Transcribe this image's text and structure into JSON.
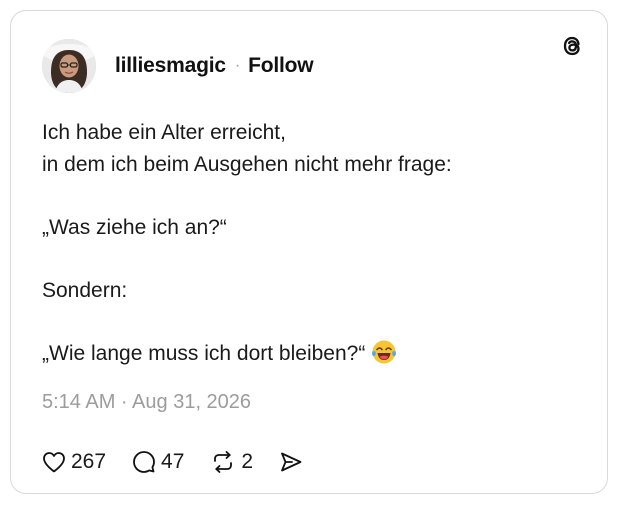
{
  "post": {
    "author": {
      "username": "lilliesmagic",
      "avatar_icon": "profile-photo"
    },
    "separator": "·",
    "follow_label": "Follow",
    "brand_icon": "threads-logo",
    "lines": [
      "Ich habe ein Alter erreicht,",
      "in dem ich beim Ausgehen nicht mehr frage:",
      "",
      "„Was ziehe ich an?“",
      "",
      "Sondern:",
      "",
      "„Wie lange muss ich dort bleiben?“"
    ],
    "trailing_emoji": "face-with-tears-of-joy",
    "timestamp": "5:14 AM · Aug 31, 2026",
    "actions": {
      "likes": {
        "icon": "heart-icon",
        "count": "267"
      },
      "replies": {
        "icon": "comment-icon",
        "count": "47"
      },
      "reposts": {
        "icon": "repost-icon",
        "count": "2"
      },
      "share": {
        "icon": "share-icon"
      }
    }
  }
}
